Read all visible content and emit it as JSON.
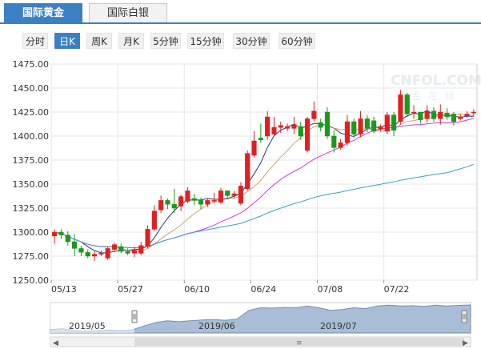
{
  "tabs": [
    {
      "label": "国际黄金",
      "active": true
    },
    {
      "label": "国际白银",
      "active": false
    }
  ],
  "periods": [
    "分时",
    "日K",
    "周K",
    "月K",
    "5分钟",
    "15分钟",
    "30分钟",
    "60分钟"
  ],
  "selected_period": "日K",
  "watermark": {
    "main": "CNFOL.COM",
    "sub": "中金在线"
  },
  "colors": {
    "up": "#e02020",
    "down": "#1a9a1a",
    "ma5": "#1f3a7a",
    "ma10": "#d9a066",
    "ma20": "#e030e0",
    "ma60": "#3aa0c0",
    "accent": "#3b7fc4"
  },
  "chart_data": {
    "type": "candlestick",
    "y_ticks": [
      "1475.00",
      "1450.00",
      "1425.00",
      "1400.00",
      "1375.00",
      "1350.00",
      "1325.00",
      "1300.00",
      "1275.00",
      "1250.00"
    ],
    "ylim": [
      1250,
      1475
    ],
    "x_ticks": [
      {
        "label": "05/13",
        "index": 0
      },
      {
        "label": "05/27",
        "index": 10
      },
      {
        "label": "06/10",
        "index": 20
      },
      {
        "label": "06/24",
        "index": 30
      },
      {
        "label": "07/08",
        "index": 40
      },
      {
        "label": "07/22",
        "index": 50
      }
    ],
    "candles": [
      [
        1296,
        1300,
        1288,
        1303
      ],
      [
        1300,
        1297,
        1293,
        1303
      ],
      [
        1297,
        1290,
        1286,
        1301
      ],
      [
        1290,
        1283,
        1275,
        1298
      ],
      [
        1283,
        1279,
        1275,
        1286
      ],
      [
        1279,
        1275,
        1273,
        1282
      ],
      [
        1275,
        1277,
        1270,
        1280
      ],
      [
        1277,
        1278,
        1275,
        1281
      ],
      [
        1273,
        1283,
        1271,
        1285
      ],
      [
        1282,
        1287,
        1280,
        1289
      ],
      [
        1285,
        1280,
        1278,
        1288
      ],
      [
        1280,
        1278,
        1276,
        1283
      ],
      [
        1278,
        1281,
        1274,
        1285
      ],
      [
        1278,
        1286,
        1276,
        1290
      ],
      [
        1285,
        1303,
        1283,
        1307
      ],
      [
        1303,
        1322,
        1301,
        1328
      ],
      [
        1323,
        1333,
        1320,
        1338
      ],
      [
        1333,
        1329,
        1324,
        1335
      ],
      [
        1329,
        1325,
        1320,
        1345
      ],
      [
        1327,
        1337,
        1322,
        1339
      ],
      [
        1332,
        1343,
        1330,
        1347
      ],
      [
        1335,
        1333,
        1328,
        1340
      ],
      [
        1333,
        1329,
        1324,
        1336
      ],
      [
        1329,
        1333,
        1326,
        1335
      ],
      [
        1333,
        1333,
        1330,
        1341
      ],
      [
        1331,
        1343,
        1329,
        1346
      ],
      [
        1343,
        1338,
        1335,
        1341
      ],
      [
        1338,
        1340,
        1335,
        1343
      ],
      [
        1330,
        1348,
        1328,
        1352
      ],
      [
        1345,
        1382,
        1343,
        1385
      ],
      [
        1380,
        1395,
        1378,
        1405
      ],
      [
        1398,
        1396,
        1393,
        1413
      ],
      [
        1400,
        1420,
        1396,
        1426
      ],
      [
        1402,
        1409,
        1400,
        1420
      ],
      [
        1409,
        1411,
        1403,
        1415
      ],
      [
        1408,
        1410,
        1405,
        1413
      ],
      [
        1408,
        1412,
        1402,
        1420
      ],
      [
        1410,
        1400,
        1396,
        1415
      ],
      [
        1385,
        1418,
        1383,
        1420
      ],
      [
        1418,
        1426,
        1415,
        1436
      ],
      [
        1414,
        1409,
        1405,
        1418
      ],
      [
        1425,
        1400,
        1397,
        1430
      ],
      [
        1400,
        1388,
        1383,
        1406
      ],
      [
        1388,
        1393,
        1386,
        1397
      ],
      [
        1393,
        1415,
        1390,
        1422
      ],
      [
        1415,
        1402,
        1398,
        1418
      ],
      [
        1402,
        1418,
        1399,
        1426
      ],
      [
        1418,
        1408,
        1404,
        1422
      ],
      [
        1416,
        1405,
        1403,
        1420
      ],
      [
        1407,
        1410,
        1405,
        1412
      ],
      [
        1405,
        1422,
        1402,
        1425
      ],
      [
        1422,
        1406,
        1400,
        1425
      ],
      [
        1415,
        1443,
        1412,
        1448
      ],
      [
        1443,
        1423,
        1420,
        1445
      ],
      [
        1425,
        1425,
        1418,
        1432
      ],
      [
        1425,
        1417,
        1413,
        1425
      ],
      [
        1418,
        1426,
        1414,
        1432
      ],
      [
        1426,
        1418,
        1415,
        1430
      ],
      [
        1418,
        1425,
        1412,
        1433
      ],
      [
        1424,
        1420,
        1417,
        1429
      ],
      [
        1423,
        1415,
        1411,
        1425
      ],
      [
        1418,
        1420,
        1416,
        1423
      ],
      [
        1421,
        1423,
        1419,
        1426
      ],
      [
        1424,
        1425,
        1421,
        1428
      ]
    ],
    "navigator": {
      "labels": [
        "2019/05",
        "2019/06",
        "2019/07"
      ],
      "values": [
        1285,
        1290,
        1280,
        1275,
        1278,
        1282,
        1280,
        1283,
        1305,
        1325,
        1335,
        1330,
        1335,
        1340,
        1342,
        1338,
        1345,
        1395,
        1410,
        1408,
        1412,
        1410,
        1420,
        1410,
        1395,
        1400,
        1410,
        1405,
        1420,
        1425,
        1420,
        1422,
        1418,
        1425,
        1420,
        1424,
        1426
      ]
    }
  }
}
